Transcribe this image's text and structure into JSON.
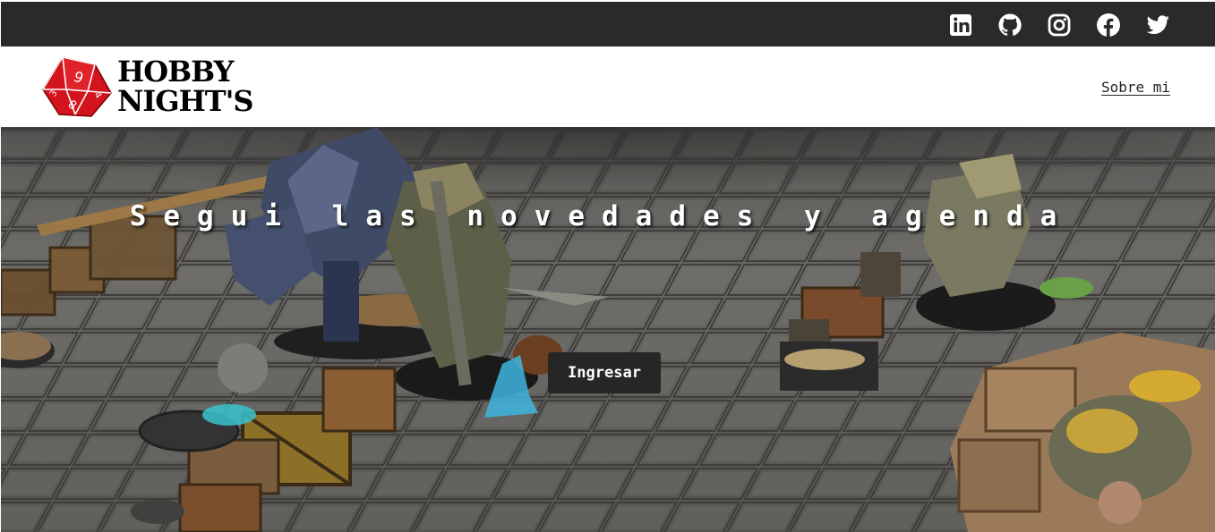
{
  "social": {
    "items": [
      {
        "icon": "linkedin-icon"
      },
      {
        "icon": "github-icon"
      },
      {
        "icon": "instagram-icon"
      },
      {
        "icon": "facebook-icon"
      },
      {
        "icon": "twitter-icon"
      }
    ]
  },
  "brand": {
    "line1": "HOBBY",
    "line2": "NIGHT'S",
    "die_color": "#d4141c",
    "logo_icon": "d10-die-icon"
  },
  "nav": {
    "about_label": "Sobre mi"
  },
  "hero": {
    "title": "Segui las novedades y agenda",
    "cta_label": "Ingresar",
    "background": "miniature-wargame-table-photo"
  },
  "colors": {
    "topbar": "#2a2a2a",
    "button": "#262626"
  }
}
